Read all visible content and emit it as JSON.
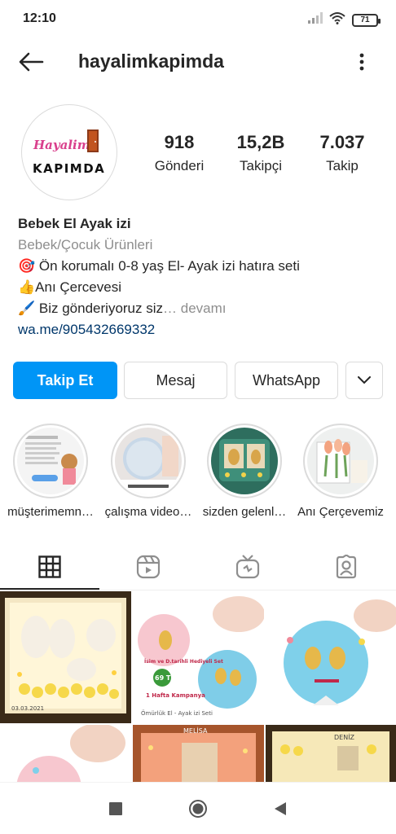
{
  "status_bar": {
    "time": "12:10",
    "battery": "71"
  },
  "header": {
    "username": "hayalimkapimda"
  },
  "avatar": {
    "logo_line1": "Hayalim",
    "logo_line2": "KAPIMDA"
  },
  "stats": [
    {
      "value": "918",
      "label": "Gönderi"
    },
    {
      "value": "15,2B",
      "label": "Takipçi"
    },
    {
      "value": "7.037",
      "label": "Takip"
    }
  ],
  "bio": {
    "name": "Bebek El Ayak izi",
    "category": "Bebek/Çocuk Ürünleri",
    "line1": "🎯 Ön korumalı 0-8 yaş El- Ayak izi hatıra seti",
    "line2": "👍Anı Çercevesi",
    "line3": "🖌️ Biz gönderiyoruz siz",
    "more": "… devamı",
    "link": "wa.me/905432669332"
  },
  "actions": {
    "follow": "Takip Et",
    "message": "Mesaj",
    "whatsapp": "WhatsApp"
  },
  "highlights": [
    {
      "label": "müşterimemn…"
    },
    {
      "label": "çalışma video…"
    },
    {
      "label": "sizden gelenl…"
    },
    {
      "label": "Anı Çerçevemiz"
    }
  ],
  "posts": {
    "post1_date": "03.03.2021",
    "post2_text1": "İsim ve D.tarihli Hediyeli Set",
    "post2_price": "69 TL",
    "post2_campaign": "1 Hafta Kampanya",
    "post2_footer": "Ömürlük El - Ayak izi Seti",
    "post5_name": "MELİSA",
    "post6_name": "DENİZ"
  },
  "colors": {
    "accent": "#0095f6",
    "link": "#00376b",
    "muted": "#8e8e8e"
  }
}
